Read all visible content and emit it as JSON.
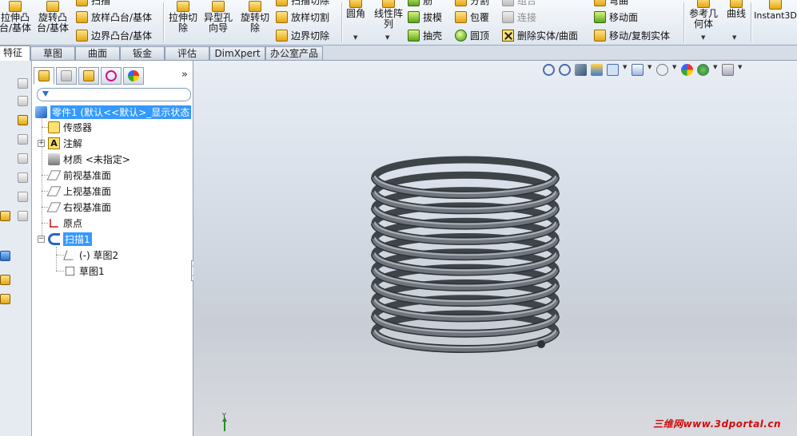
{
  "ribbon": {
    "extrude_boss": "拉伸凸\n台/基体",
    "revolve_boss": "旋转凸\n台/基体",
    "sweep_boss": "扫描",
    "loft_boss": "放样凸台/基体",
    "boundary_boss": "边界凸台/基体",
    "extrude_cut": "拉伸切\n除",
    "hole_wizard": "异型孔\n向导",
    "revolve_cut": "旋转切\n除",
    "sweep_cut": "扫描切除",
    "loft_cut": "放样切割",
    "boundary_cut": "边界切除",
    "fillet": "圆角",
    "linear_pattern": "线性阵\n列",
    "rib": "筋",
    "draft": "拔模",
    "shell": "抽壳",
    "split": "分割",
    "wrap": "包覆",
    "dome": "圆顶",
    "combine": "组合",
    "join": "连接",
    "delete_body": "删除实体/曲面",
    "flex": "弯曲",
    "move_face": "移动面",
    "move_copy": "移动/复制实体",
    "ref_geometry": "参考几\n何体",
    "curves": "曲线",
    "instant3d": "Instant3D"
  },
  "tabs": [
    "特征",
    "草图",
    "曲面",
    "钣金",
    "评估",
    "DimXpert",
    "办公室产品"
  ],
  "feature_tree": {
    "root": "零件1 (默认<<默认>_显示状态",
    "items": [
      "传感器",
      "注解",
      "材质 <未指定>",
      "前视基准面",
      "上视基准面",
      "右视基准面",
      "原点",
      "扫描1",
      "(-) 草图2",
      "草图1"
    ]
  },
  "fm_more": "»",
  "watermark": "三维网www.3dportal.cn",
  "triad_label": "Y",
  "model": {
    "type": "helical spring (sweep)",
    "coil_turns": 11,
    "color": "#6f757d"
  }
}
